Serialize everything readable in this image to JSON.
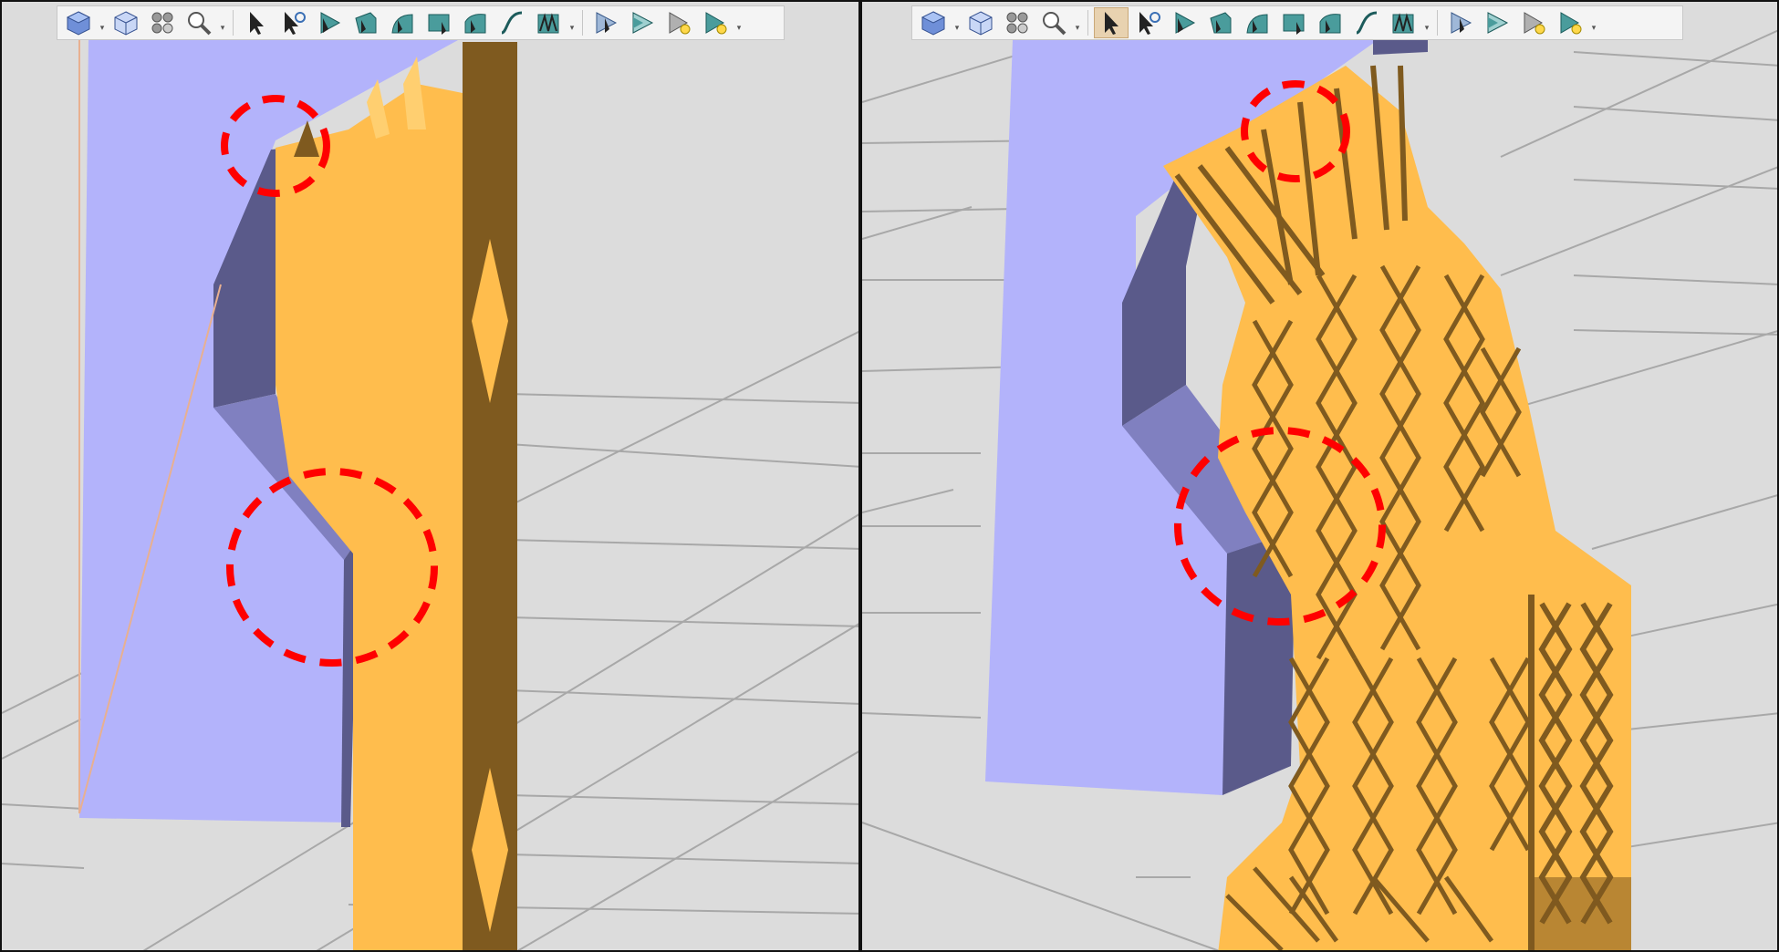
{
  "colors": {
    "background": "#dcdcdc",
    "grid_line": "#a8a8a8",
    "part_face": "#b3b3fb",
    "part_side": "#5a5a8a",
    "part_inner": "#8080c0",
    "support_light": "#ffbd4d",
    "support_dark": "#7f5a1f",
    "highlight_circle": "#ff0000",
    "toolbar_bg": "#f4f4f4",
    "toolbar_active": "#e8d2b0"
  },
  "views": [
    {
      "id": "left",
      "description_name": "block-support-view",
      "toolbar": {
        "active_index": -1,
        "buttons": [
          {
            "icon": "solid-cube-icon",
            "has_dropdown": true
          },
          {
            "icon": "wireframe-cube-icon",
            "has_dropdown": false
          },
          {
            "icon": "scatter-points-icon",
            "has_dropdown": false
          },
          {
            "icon": "magnifier-icon",
            "has_dropdown": true
          },
          {
            "icon": "pointer-arrow-icon",
            "has_dropdown": false
          },
          {
            "icon": "pointer-rotate-icon",
            "has_dropdown": false
          },
          {
            "icon": "point-support-icon",
            "has_dropdown": false
          },
          {
            "icon": "line-support-icon",
            "has_dropdown": false
          },
          {
            "icon": "curve-support-icon",
            "has_dropdown": false
          },
          {
            "icon": "block-support-icon",
            "has_dropdown": false
          },
          {
            "icon": "arc-support-icon",
            "has_dropdown": false
          },
          {
            "icon": "spline-support-icon",
            "has_dropdown": false
          },
          {
            "icon": "mesh-support-icon",
            "has_dropdown": true
          },
          {
            "icon": "select-arrow-icon",
            "has_dropdown": false
          },
          {
            "icon": "play-triangle-icon",
            "has_dropdown": false
          },
          {
            "icon": "bulb-arrow-icon",
            "has_dropdown": false
          },
          {
            "icon": "bulb-arrow-green-icon",
            "has_dropdown": true
          }
        ]
      }
    },
    {
      "id": "right",
      "description_name": "lattice-support-view",
      "toolbar": {
        "active_index": 4,
        "buttons": [
          {
            "icon": "solid-cube-icon",
            "has_dropdown": true
          },
          {
            "icon": "wireframe-cube-icon",
            "has_dropdown": false
          },
          {
            "icon": "scatter-points-icon",
            "has_dropdown": false
          },
          {
            "icon": "magnifier-icon",
            "has_dropdown": true
          },
          {
            "icon": "pointer-arrow-icon",
            "has_dropdown": false
          },
          {
            "icon": "pointer-rotate-icon",
            "has_dropdown": false
          },
          {
            "icon": "point-support-icon",
            "has_dropdown": false
          },
          {
            "icon": "line-support-icon",
            "has_dropdown": false
          },
          {
            "icon": "curve-support-icon",
            "has_dropdown": false
          },
          {
            "icon": "block-support-icon",
            "has_dropdown": false
          },
          {
            "icon": "arc-support-icon",
            "has_dropdown": false
          },
          {
            "icon": "spline-support-icon",
            "has_dropdown": false
          },
          {
            "icon": "mesh-support-icon",
            "has_dropdown": true
          },
          {
            "icon": "select-arrow-icon",
            "has_dropdown": false
          },
          {
            "icon": "play-triangle-icon",
            "has_dropdown": false
          },
          {
            "icon": "bulb-arrow-icon",
            "has_dropdown": false
          },
          {
            "icon": "bulb-arrow-green-icon",
            "has_dropdown": true
          }
        ]
      }
    }
  ]
}
